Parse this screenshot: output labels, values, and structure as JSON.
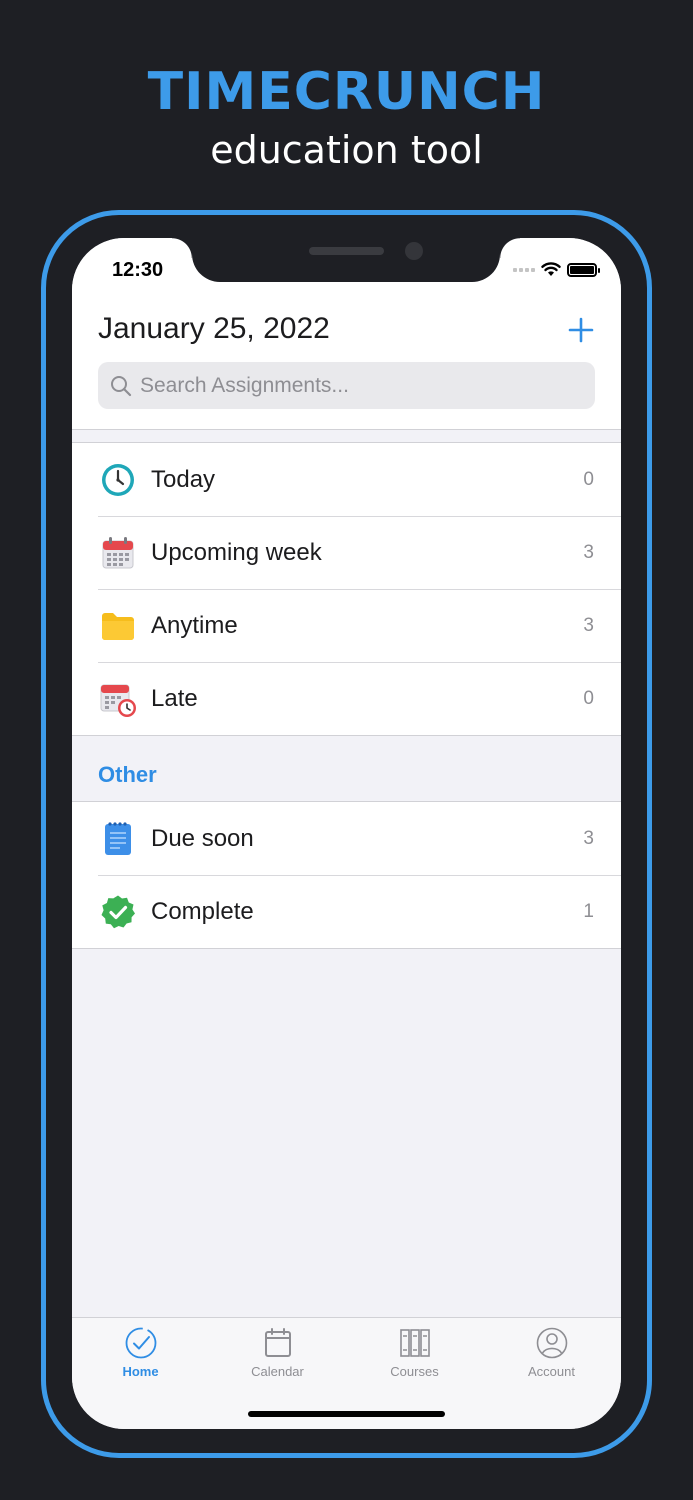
{
  "promo": {
    "title": "TIMECRUNCH",
    "subtitle": "education tool"
  },
  "status_bar": {
    "time": "12:30"
  },
  "header": {
    "date": "January 25, 2022",
    "add_icon": "plus-icon"
  },
  "search": {
    "placeholder": "Search Assignments...",
    "value": ""
  },
  "main_list": [
    {
      "label": "Today",
      "count": "0",
      "icon": "clock-icon"
    },
    {
      "label": "Upcoming week",
      "count": "3",
      "icon": "calendar-icon"
    },
    {
      "label": "Anytime",
      "count": "3",
      "icon": "folder-icon"
    },
    {
      "label": "Late",
      "count": "0",
      "icon": "late-calendar-icon"
    }
  ],
  "other": {
    "header": "Other",
    "items": [
      {
        "label": "Due soon",
        "count": "3",
        "icon": "notepad-icon"
      },
      {
        "label": "Complete",
        "count": "1",
        "icon": "check-badge-icon"
      }
    ]
  },
  "tabs": [
    {
      "label": "Home",
      "icon": "checkmark-circle-icon",
      "active": true
    },
    {
      "label": "Calendar",
      "icon": "calendar-outline-icon",
      "active": false
    },
    {
      "label": "Courses",
      "icon": "books-icon",
      "active": false
    },
    {
      "label": "Account",
      "icon": "person-circle-icon",
      "active": false
    }
  ],
  "colors": {
    "accent": "#3d9be9",
    "background": "#1e1f24",
    "link": "#2f8de4"
  }
}
